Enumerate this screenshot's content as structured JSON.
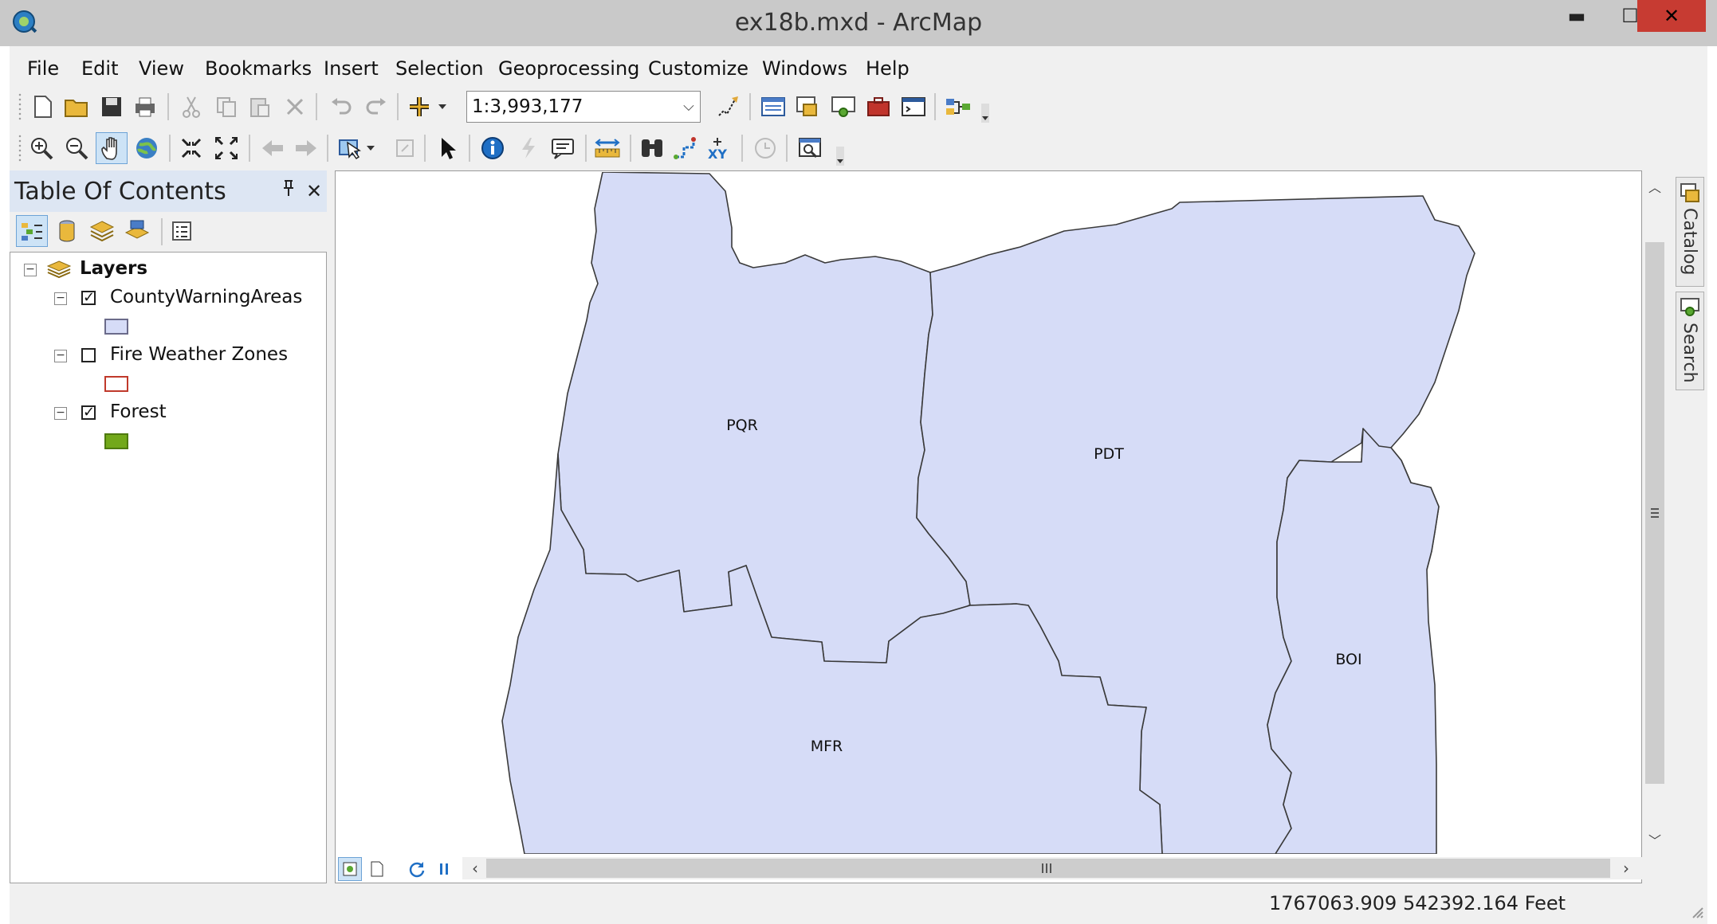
{
  "window": {
    "title": "ex18b.mxd - ArcMap",
    "minimize_glyph": "▬",
    "maximize_glyph": "☐",
    "close_glyph": "✕"
  },
  "menu": [
    "File",
    "Edit",
    "View",
    "Bookmarks",
    "Insert",
    "Selection",
    "Geoprocessing",
    "Customize",
    "Windows",
    "Help"
  ],
  "standard_toolbar": {
    "scale_value": "1:3,993,177",
    "buttons": [
      "new-document-icon",
      "open-folder-icon",
      "save-icon",
      "print-icon",
      "cut-icon",
      "copy-icon",
      "paste-icon",
      "delete-icon",
      "undo-icon",
      "redo-icon",
      "add-data-icon",
      "editor-toolbar-icon",
      "table-of-contents-icon",
      "catalog-window-icon",
      "search-window-icon",
      "arctoolbox-icon",
      "python-window-icon",
      "model-builder-icon"
    ]
  },
  "tools_toolbar": {
    "buttons": [
      "zoom-in-icon",
      "zoom-out-icon",
      "pan-icon",
      "full-extent-icon",
      "fixed-zoom-in-icon",
      "fixed-zoom-out-icon",
      "go-back-icon",
      "go-forward-icon",
      "select-features-icon",
      "clear-selection-icon",
      "select-elements-icon",
      "identify-icon",
      "hyperlink-icon",
      "html-popup-icon",
      "measure-icon",
      "find-icon",
      "find-route-icon",
      "go-to-xy-icon",
      "time-slider-icon",
      "viewer-window-icon"
    ]
  },
  "toc": {
    "title": "Table Of Contents",
    "pin_glyph": "📌",
    "close_glyph": "✕",
    "root_label": "Layers",
    "layers": [
      {
        "name": "CountyWarningAreas",
        "checked": true,
        "symbol_fill": "#d6dcf7",
        "symbol_stroke": "#6b6b8a"
      },
      {
        "name": "Fire Weather Zones",
        "checked": false,
        "symbol_fill": "#ffffff",
        "symbol_stroke": "#c0392b"
      },
      {
        "name": "Forest",
        "checked": true,
        "symbol_fill": "#72a81a",
        "symbol_stroke": "#4e7a0e"
      }
    ]
  },
  "map": {
    "fill_color": "#d6dcf7",
    "stroke_color": "#3a3a3a",
    "region_labels": [
      "PQR",
      "PDT",
      "BOI",
      "MFR"
    ]
  },
  "right_dock": {
    "tabs": [
      "Catalog",
      "Search"
    ]
  },
  "status": {
    "coordinates": "1767063.909  542392.164 Feet"
  }
}
